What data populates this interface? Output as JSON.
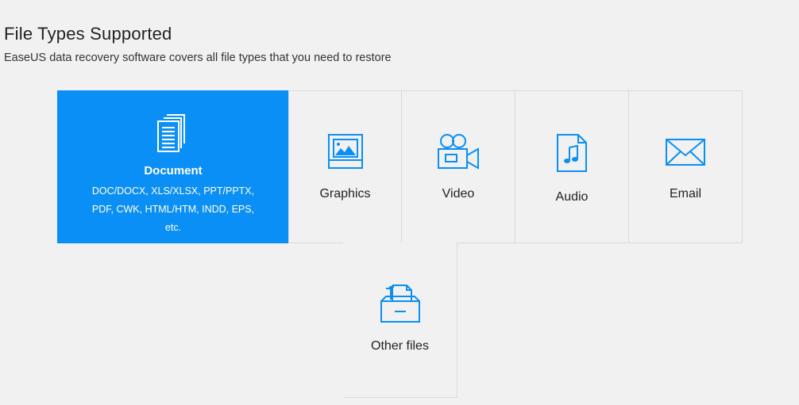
{
  "header": {
    "title": "File Types Supported",
    "subtitle": "EaseUS data recovery software covers all file types that you need to restore"
  },
  "tiles": {
    "document": {
      "label": "Document",
      "icon": "document-stack-icon",
      "desc_line1": "DOC/DOCX, XLS/XLSX, PPT/PPTX,",
      "desc_line2": "PDF, CWK, HTML/HTM, INDD, EPS,",
      "desc_line3": "etc."
    },
    "graphics": {
      "label": "Graphics",
      "icon": "image-icon"
    },
    "video": {
      "label": "Video",
      "icon": "video-camera-icon"
    },
    "audio": {
      "label": "Audio",
      "icon": "music-file-icon"
    },
    "email": {
      "label": "Email",
      "icon": "envelope-icon"
    },
    "other": {
      "label": "Other files",
      "icon": "file-tray-icon"
    }
  },
  "colors": {
    "accent": "#0a8ff7",
    "icon": "#0a8ff7",
    "background": "#f1f1f1",
    "border": "#d9d9d9"
  }
}
